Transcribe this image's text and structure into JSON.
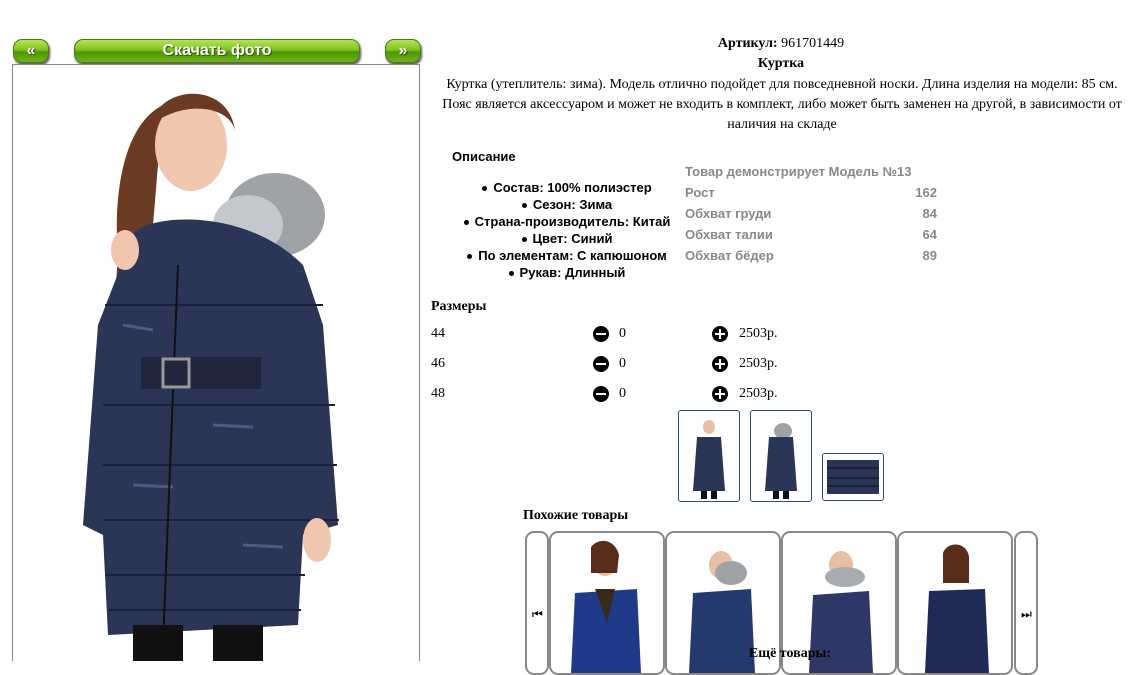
{
  "gallery": {
    "prev_label": "«",
    "download_label": "Скачать фото",
    "next_label": "»"
  },
  "product": {
    "article_label": "Артикул:",
    "article_value": "961701449",
    "title": "Куртка",
    "description": "Куртка (утеплитель: зима). Модель отлично подойдет для повседневной носки. Длина изделия на модели: 85 см. Пояс является аксессуаром и может не входить в комплект, либо может быть заменен на другой, в зависимости от наличия на складе",
    "desc_heading": "Описание",
    "attributes": [
      "Состав: 100% полиэстер",
      "Сезон: Зима",
      "Страна-производитель: Китай",
      "Цвет: Синий",
      "По элементам: С капюшоном",
      "Рукав: Длинный"
    ]
  },
  "model": {
    "heading": "Товар демонстрирует Модель №13",
    "rows": [
      {
        "label": "Рост",
        "value": "162"
      },
      {
        "label": "Обхват груди",
        "value": "84"
      },
      {
        "label": "Обхват талии",
        "value": "64"
      },
      {
        "label": "Обхват бёдер",
        "value": "89"
      }
    ]
  },
  "sizes": {
    "heading": "Размеры",
    "rows": [
      {
        "size": "44",
        "qty": "0",
        "price": "2503р."
      },
      {
        "size": "46",
        "qty": "0",
        "price": "2503р."
      },
      {
        "size": "48",
        "qty": "0",
        "price": "2503р."
      }
    ]
  },
  "similar": {
    "heading": "Похожие товары",
    "more_label": "Ещё товары:"
  },
  "colors": {
    "accent_green": "#6fb516",
    "jacket_navy": "#2b3556",
    "thumb_border": "#2a4d7a"
  }
}
